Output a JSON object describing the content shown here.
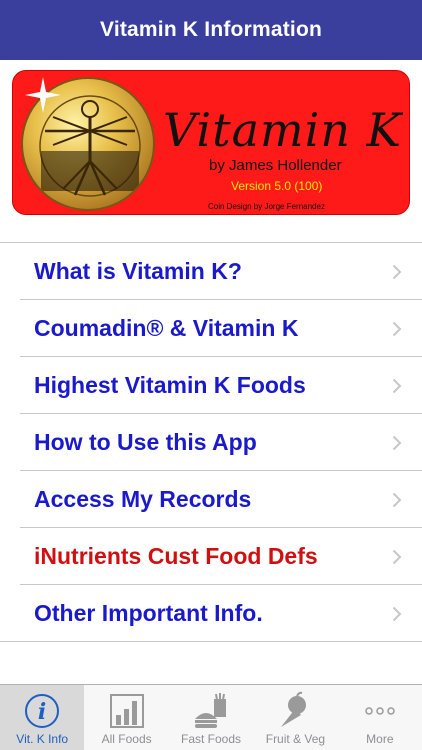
{
  "nav": {
    "title": "Vitamin K Information"
  },
  "banner": {
    "brand": "Vitamin K",
    "byline": "by James Hollender",
    "version": "Version 5.0 (100)",
    "credit": "Coin Design by Jorge Fernandez"
  },
  "menu": [
    {
      "label": "What is Vitamin K?"
    },
    {
      "label": "Coumadin® & Vitamin K"
    },
    {
      "label": "Highest Vitamin K Foods"
    },
    {
      "label": "How to Use this App"
    },
    {
      "label": "Access My Records"
    },
    {
      "label": "iNutrients Cust Food Defs"
    },
    {
      "label": "Other Important Info."
    }
  ],
  "tabs": [
    {
      "label": "Vit. K Info",
      "icon": "info-icon"
    },
    {
      "label": "All Foods",
      "icon": "bar-chart-icon"
    },
    {
      "label": "Fast Foods",
      "icon": "fast-food-icon"
    },
    {
      "label": "Fruit & Veg",
      "icon": "fruit-veg-icon"
    },
    {
      "label": "More",
      "icon": "more-icon"
    }
  ],
  "colors": {
    "nav_bg": "#3a3f9e",
    "link_blue": "#1a1acc",
    "link_red": "#d01010",
    "banner_red": "#ff1a1a",
    "tab_active": "#1f5fc4"
  }
}
